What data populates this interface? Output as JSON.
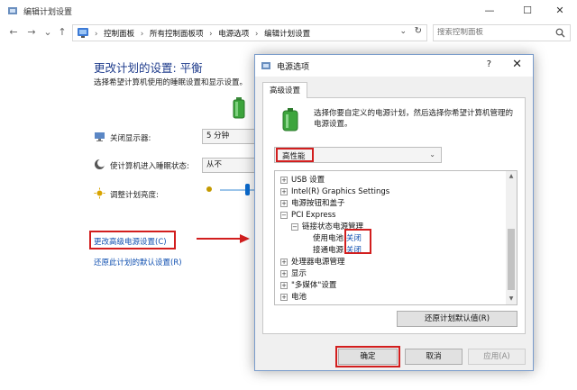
{
  "window": {
    "title": "编辑计划设置",
    "controls": {
      "minimize": "—",
      "maximize": "☐",
      "close": "✕"
    }
  },
  "nav": {
    "back": "←",
    "forward": "→",
    "history": "⌄",
    "up": "↑",
    "breadcrumbs": [
      "控制面板",
      "所有控制面板项",
      "电源选项",
      "编辑计划设置"
    ],
    "separator": "›",
    "address_dropdown": "⌄",
    "refresh": "↻",
    "search_placeholder": "搜索控制面板"
  },
  "plan": {
    "title": "更改计划的设置: 平衡",
    "description": "选择希望计算机使用的睡眠设置和显示设置。",
    "settings": [
      {
        "label": "关闭显示器:",
        "value": "5 分钟",
        "icon": "monitor-icon"
      },
      {
        "label": "使计算机进入睡眠状态:",
        "value": "从不",
        "icon": "moon-icon"
      },
      {
        "label": "调整计划亮度:",
        "icon": "sun-icon"
      }
    ],
    "advanced_link": "更改高级电源设置(C)",
    "restore_link": "还原此计划的默认设置(R)"
  },
  "dialog": {
    "title": "电源选项",
    "help": "?",
    "close": "✕",
    "tab": "高级设置",
    "description": "选择你要自定义的电源计划，然后选择你希望计算机管理的电源设置。",
    "plan_value": "高性能",
    "plan_arrow": "⌄",
    "tree": [
      {
        "text": "USB 设置",
        "expander": "+"
      },
      {
        "text": "Intel(R) Graphics Settings",
        "expander": "+"
      },
      {
        "text": "电源按钮和盖子",
        "expander": "+"
      },
      {
        "text": "PCI Express",
        "expander": "−"
      },
      {
        "text": "链接状态电源管理",
        "expander": "−"
      },
      {
        "text": "使用电池:",
        "value": "关闭"
      },
      {
        "text": "接通电源:",
        "value": "关闭"
      },
      {
        "text": "处理器电源管理",
        "expander": "+"
      },
      {
        "text": "显示",
        "expander": "+"
      },
      {
        "text": "\"多媒体\"设置",
        "expander": "+"
      },
      {
        "text": "电池",
        "expander": "+"
      }
    ],
    "scroll_up": "▲",
    "scroll_down": "▼",
    "restore_button": "还原计划默认值(R)",
    "ok_button": "确定",
    "cancel_button": "取消",
    "apply_button": "应用(A)"
  },
  "colors": {
    "link": "#0f4fb0",
    "title": "#1f3c8c",
    "highlight": "#d21e1e",
    "battery": "#3da53d"
  }
}
